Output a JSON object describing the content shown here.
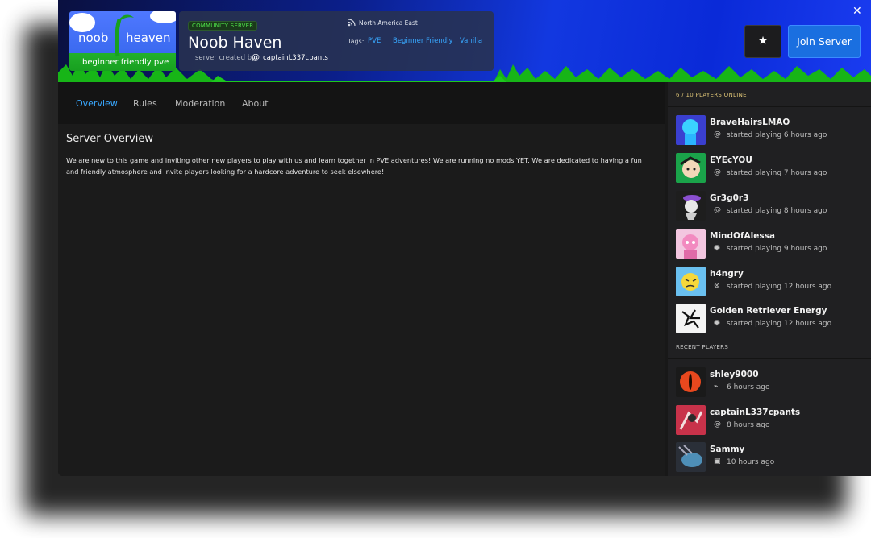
{
  "banner": {
    "logo_word1": "noob",
    "logo_word2": "heaven",
    "logo_tagline": "beginner friendly pve",
    "badge": "COMMUNITY SERVER",
    "title": "Noob Haven",
    "created_by_label": "server created by",
    "creator": "captainL337cpants",
    "region": "North America East",
    "tags_label": "Tags:",
    "tags": [
      "PVE",
      "Beginner Friendly",
      "Vanilla"
    ],
    "favorite_icon": "star-icon",
    "join_label": "Join Server",
    "close_icon": "close-icon"
  },
  "nav": {
    "tabs": [
      {
        "label": "Overview",
        "active": true
      },
      {
        "label": "Rules",
        "active": false
      },
      {
        "label": "Moderation",
        "active": false
      },
      {
        "label": "About",
        "active": false
      }
    ]
  },
  "overview": {
    "title": "Server Overview",
    "text": "We are new to this game and inviting other new players to play with us and learn together in PVE adventures! We are running no mods YET. We are dedicated to having a fun and friendly atmosphere and invite players looking for a hardcore adventure to seek elsewhere!"
  },
  "sidebar": {
    "online_header": "6 / 10  PLAYERS ONLINE",
    "online_players": [
      {
        "name": "BraveHairsLMAO",
        "status": "started playing 6 hours ago",
        "platform": "at-icon"
      },
      {
        "name": "EYEcYOU",
        "status": "started playing 7 hours ago",
        "platform": "at-icon"
      },
      {
        "name": "Gr3g0r3",
        "status": "started playing 8 hours ago",
        "platform": "at-icon"
      },
      {
        "name": "MindOfAlessa",
        "status": "started playing 9 hours ago",
        "platform": "steam-icon"
      },
      {
        "name": "h4ngry",
        "status": "started playing 12 hours ago",
        "platform": "xbox-icon"
      },
      {
        "name": "Golden Retriever Energy",
        "status": "started playing 12 hours ago",
        "platform": "steam-icon"
      }
    ],
    "recent_header": "RECENT PLAYERS",
    "recent_players": [
      {
        "name": "shley9000",
        "status": "6 hours ago",
        "platform": "playstation-icon"
      },
      {
        "name": "captainL337cpants",
        "status": "8 hours ago",
        "platform": "at-icon"
      },
      {
        "name": "Sammy",
        "status": "10 hours ago",
        "platform": "switch-icon"
      }
    ]
  },
  "colors": {
    "accent": "#39a8ff",
    "join_button": "#1a6fe0",
    "badge_green": "#4ee04a",
    "online_header": "#d9c074"
  }
}
